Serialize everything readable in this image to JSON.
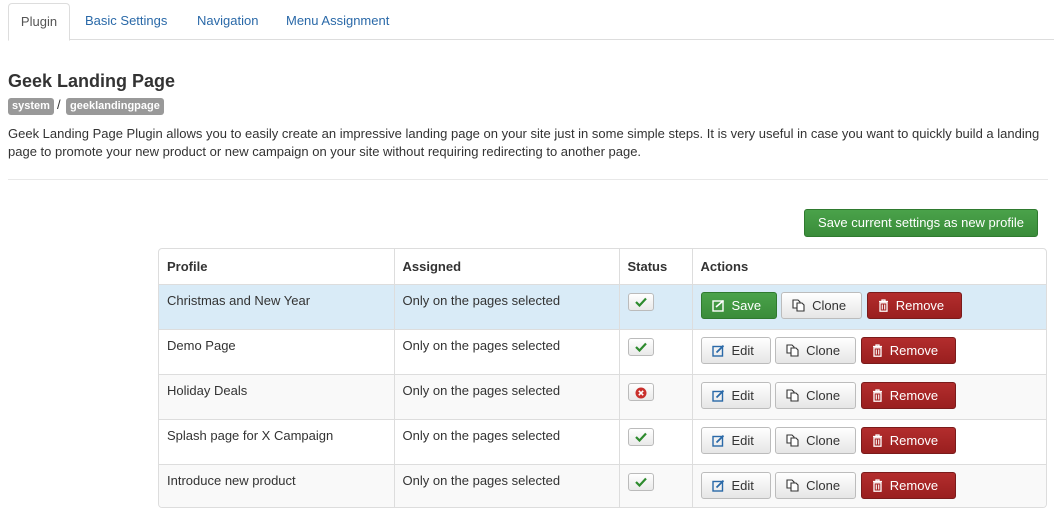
{
  "tabs": [
    {
      "label": "Plugin",
      "active": true
    },
    {
      "label": "Basic Settings",
      "active": false
    },
    {
      "label": "Navigation",
      "active": false
    },
    {
      "label": "Menu Assignment",
      "active": false
    }
  ],
  "header": {
    "title": "Geek Landing Page",
    "labels": [
      "system",
      "geeklandingpage"
    ],
    "separator": "/",
    "description": "Geek Landing Page Plugin allows you to easily create an impressive landing page on your site just in some simple steps. It is very useful in case you want to quickly build a landing page to promote your new product or new campaign on your site without requiring redirecting to another page."
  },
  "toolbar": {
    "save_profile_label": "Save current settings as new profile"
  },
  "table": {
    "columns": [
      "Profile",
      "Assigned",
      "Status",
      "Actions"
    ],
    "rows": [
      {
        "profile": "Christmas and New Year",
        "assigned": "Only on the pages selected",
        "status": "enabled",
        "status_icon": "check-icon",
        "selected": true,
        "primary_action": "Save",
        "clone": "Clone",
        "remove": "Remove"
      },
      {
        "profile": "Demo Page",
        "assigned": "Only on the pages selected",
        "status": "enabled",
        "status_icon": "check-icon",
        "selected": false,
        "primary_action": "Edit",
        "clone": "Clone",
        "remove": "Remove"
      },
      {
        "profile": "Holiday Deals",
        "assigned": "Only on the pages selected",
        "status": "disabled",
        "status_icon": "x-circle-icon",
        "selected": false,
        "primary_action": "Edit",
        "clone": "Clone",
        "remove": "Remove"
      },
      {
        "profile": "Splash page for X Campaign",
        "assigned": "Only on the pages selected",
        "status": "enabled",
        "status_icon": "check-icon",
        "selected": false,
        "primary_action": "Edit",
        "clone": "Clone",
        "remove": "Remove"
      },
      {
        "profile": "Introduce new product",
        "assigned": "Only on the pages selected",
        "status": "enabled",
        "status_icon": "check-icon",
        "selected": false,
        "primary_action": "Edit",
        "clone": "Clone",
        "remove": "Remove"
      }
    ]
  },
  "colors": {
    "link": "#2a69a8",
    "success": "#3a8c3a",
    "danger": "#a52525",
    "selected_row": "#d9ebf7",
    "label_bg": "#999999"
  }
}
